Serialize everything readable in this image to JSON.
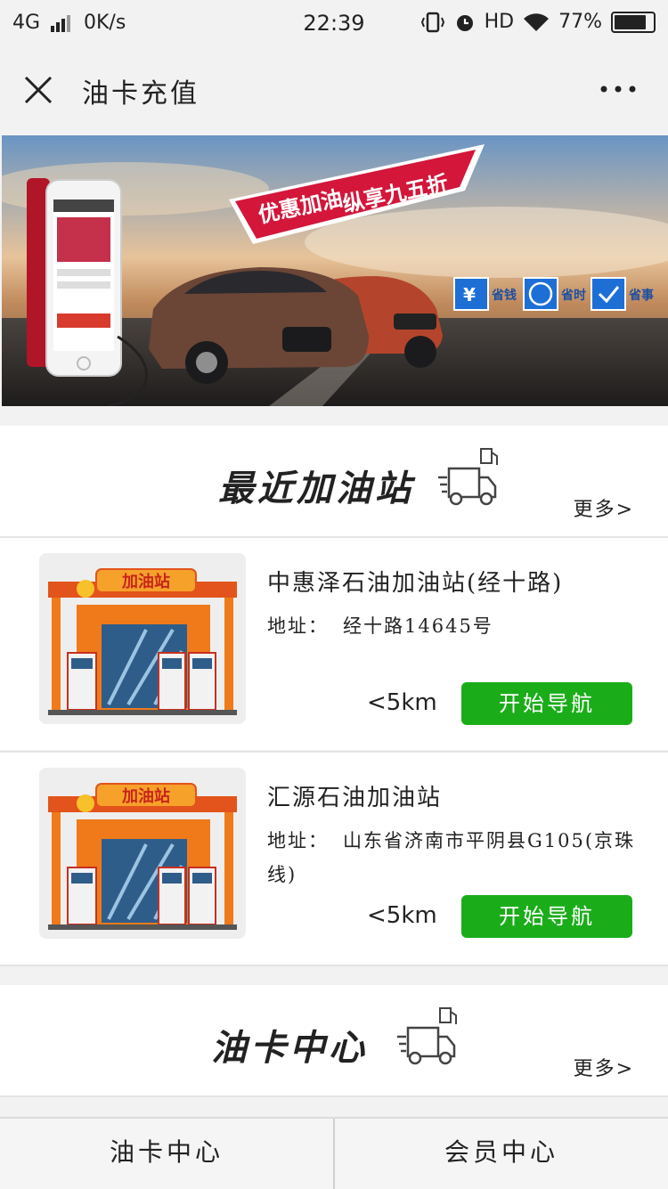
{
  "status_bar": {
    "network": "4G",
    "speed": "0K/s",
    "time": "22:39",
    "hd": "HD",
    "battery": "77%",
    "battery_level": 0.77
  },
  "nav": {
    "title": "油卡充值"
  },
  "banner": {
    "headline_1": "优惠加油",
    "headline_2": "纵享九五折",
    "badges": [
      "省钱",
      "省时",
      "省事"
    ]
  },
  "nearby": {
    "title": "最近加油站",
    "more": "更多>"
  },
  "stations": [
    {
      "name": "中惠泽石油加油站(经十路)",
      "address_label": "地址：",
      "address": "经十路14645号",
      "distance": "<5km",
      "nav_button": "开始导航",
      "sign": "加油站"
    },
    {
      "name": "汇源石油加油站",
      "address_label": "地址：",
      "address": "山东省济南市平阴县G105(京珠线)",
      "distance": "<5km",
      "nav_button": "开始导航",
      "sign": "加油站"
    }
  ],
  "card_center": {
    "title": "油卡中心",
    "more": "更多>"
  },
  "tabbar": {
    "tabs": [
      "油卡中心",
      "会员中心"
    ]
  },
  "colors": {
    "accent_green": "#1aad19",
    "banner_red": "#d3163a"
  }
}
